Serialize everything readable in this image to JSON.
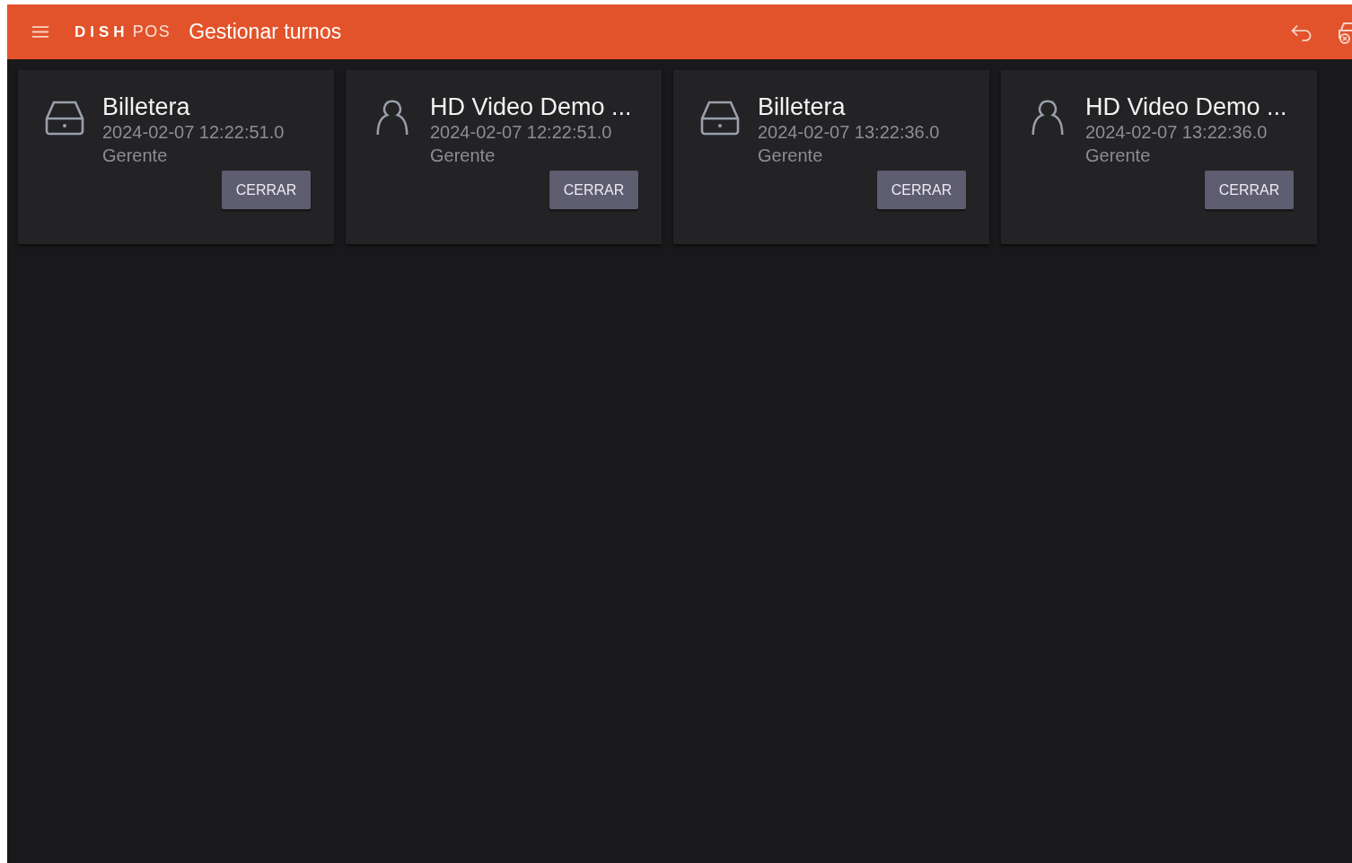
{
  "app_bar": {
    "logo_bold": "DISH",
    "logo_light": "POS",
    "title": "Gestionar turnos"
  },
  "shifts": [
    {
      "kind": "drawer",
      "name": "Billetera",
      "time": "2024-02-07 12:22:51.0",
      "role": "Gerente",
      "action": "CERRAR"
    },
    {
      "kind": "person",
      "name": "HD Video Demo ...",
      "time": "2024-02-07 12:22:51.0",
      "role": "Gerente",
      "action": "CERRAR"
    },
    {
      "kind": "drawer",
      "name": "Billetera",
      "time": "2024-02-07 13:22:36.0",
      "role": "Gerente",
      "action": "CERRAR"
    },
    {
      "kind": "person",
      "name": "HD Video Demo ...",
      "time": "2024-02-07 13:22:36.0",
      "role": "Gerente",
      "action": "CERRAR"
    }
  ]
}
